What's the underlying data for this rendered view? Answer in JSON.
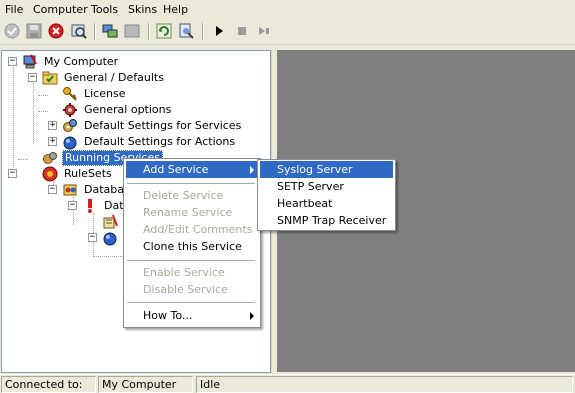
{
  "menubar": {
    "items": [
      "File",
      "Computer",
      "Tools",
      "Skins",
      "Help"
    ]
  },
  "toolbar": {
    "buttons": [
      "check-icon",
      "save-icon",
      "stop-icon",
      "search-icon",
      "network-icon",
      "window-icon",
      "refresh-icon",
      "settings-icon",
      "play-icon",
      "stop-square-icon",
      "step-icon"
    ]
  },
  "tree": {
    "root": "My Computer",
    "general": "General / Defaults",
    "license": "License",
    "general_options": "General options",
    "default_services": "Default Settings for Services",
    "default_actions": "Default Settings for Actions",
    "running_services": "Running Services",
    "rulesets": "RuleSets",
    "database": "Databas",
    "data": "Data"
  },
  "context_menu": {
    "add_service": "Add Service",
    "delete_service": "Delete Service",
    "rename_service": "Rename Service",
    "add_edit_comments": "Add/Edit Comments",
    "clone_service": "Clone this Service",
    "enable_service": "Enable Service",
    "disable_service": "Disable Service",
    "how_to": "How To..."
  },
  "submenu": {
    "syslog": "Syslog Server",
    "setp": "SETP Server",
    "heartbeat": "Heartbeat",
    "snmp": "SNMP Trap Receiver"
  },
  "statusbar": {
    "connected_label": "Connected to:",
    "computer": "My Computer",
    "state": "Idle"
  },
  "colors": {
    "selection": "#316ac5",
    "right_panel": "#808080",
    "chrome": "#ece9d8"
  }
}
